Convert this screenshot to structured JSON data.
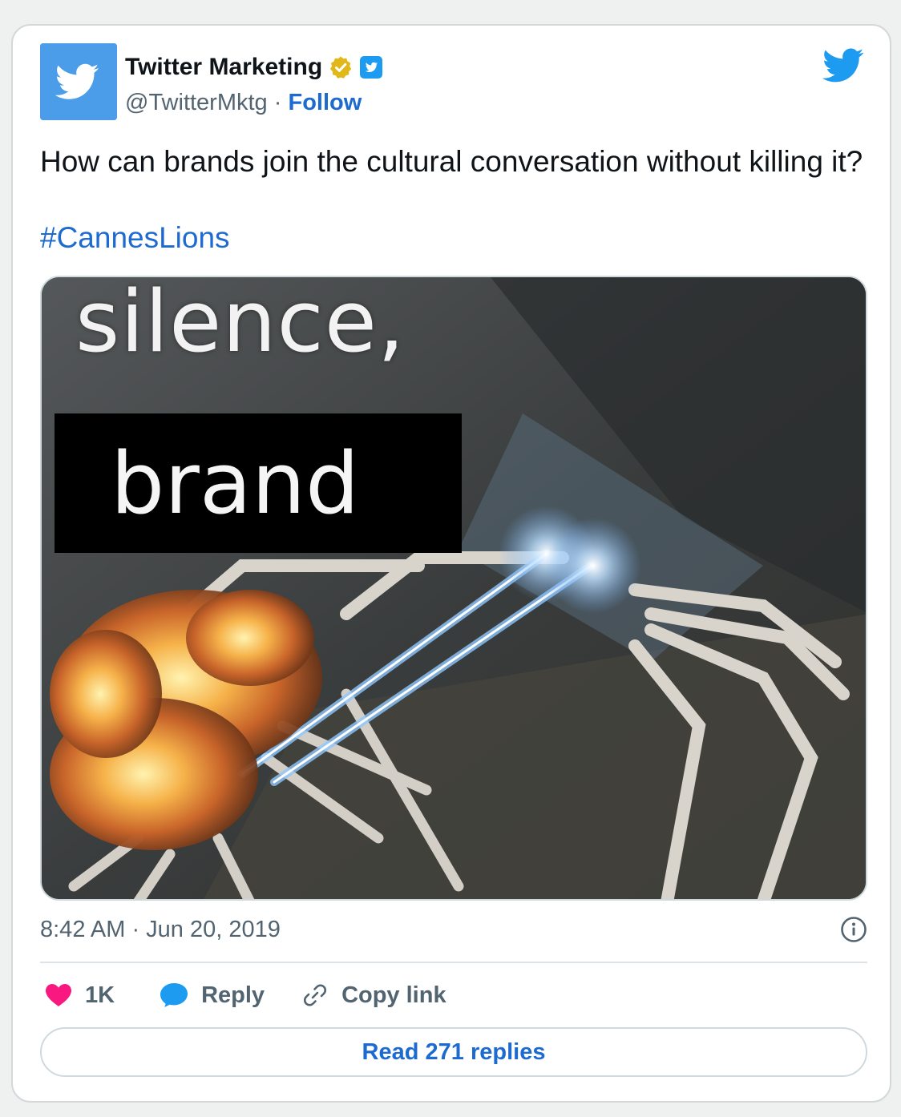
{
  "account": {
    "display_name": "Twitter Marketing",
    "handle": "@TwitterMktg",
    "separator": "·",
    "follow_label": "Follow",
    "avatar_icon": "twitter-bird-icon",
    "badges": [
      "verified-badge-icon",
      "twitter-affiliate-badge-icon"
    ]
  },
  "tweet": {
    "text": "How can brands join the cultural conversation without killing it?",
    "hashtag": "#CannesLions",
    "media": {
      "caption_line_1": "silence,",
      "caption_line_2": "brand"
    }
  },
  "meta": {
    "timestamp": "8:42 AM · Jun 20, 2019"
  },
  "actions": {
    "likes_count": "1K",
    "reply_label": "Reply",
    "copy_link_label": "Copy link"
  },
  "footer": {
    "read_replies_label": "Read 271 replies"
  },
  "colors": {
    "brand_blue": "#1d9bf0",
    "link_blue": "#1d6ad0",
    "like_pink": "#f91880",
    "verified_gold": "#e2b719"
  }
}
